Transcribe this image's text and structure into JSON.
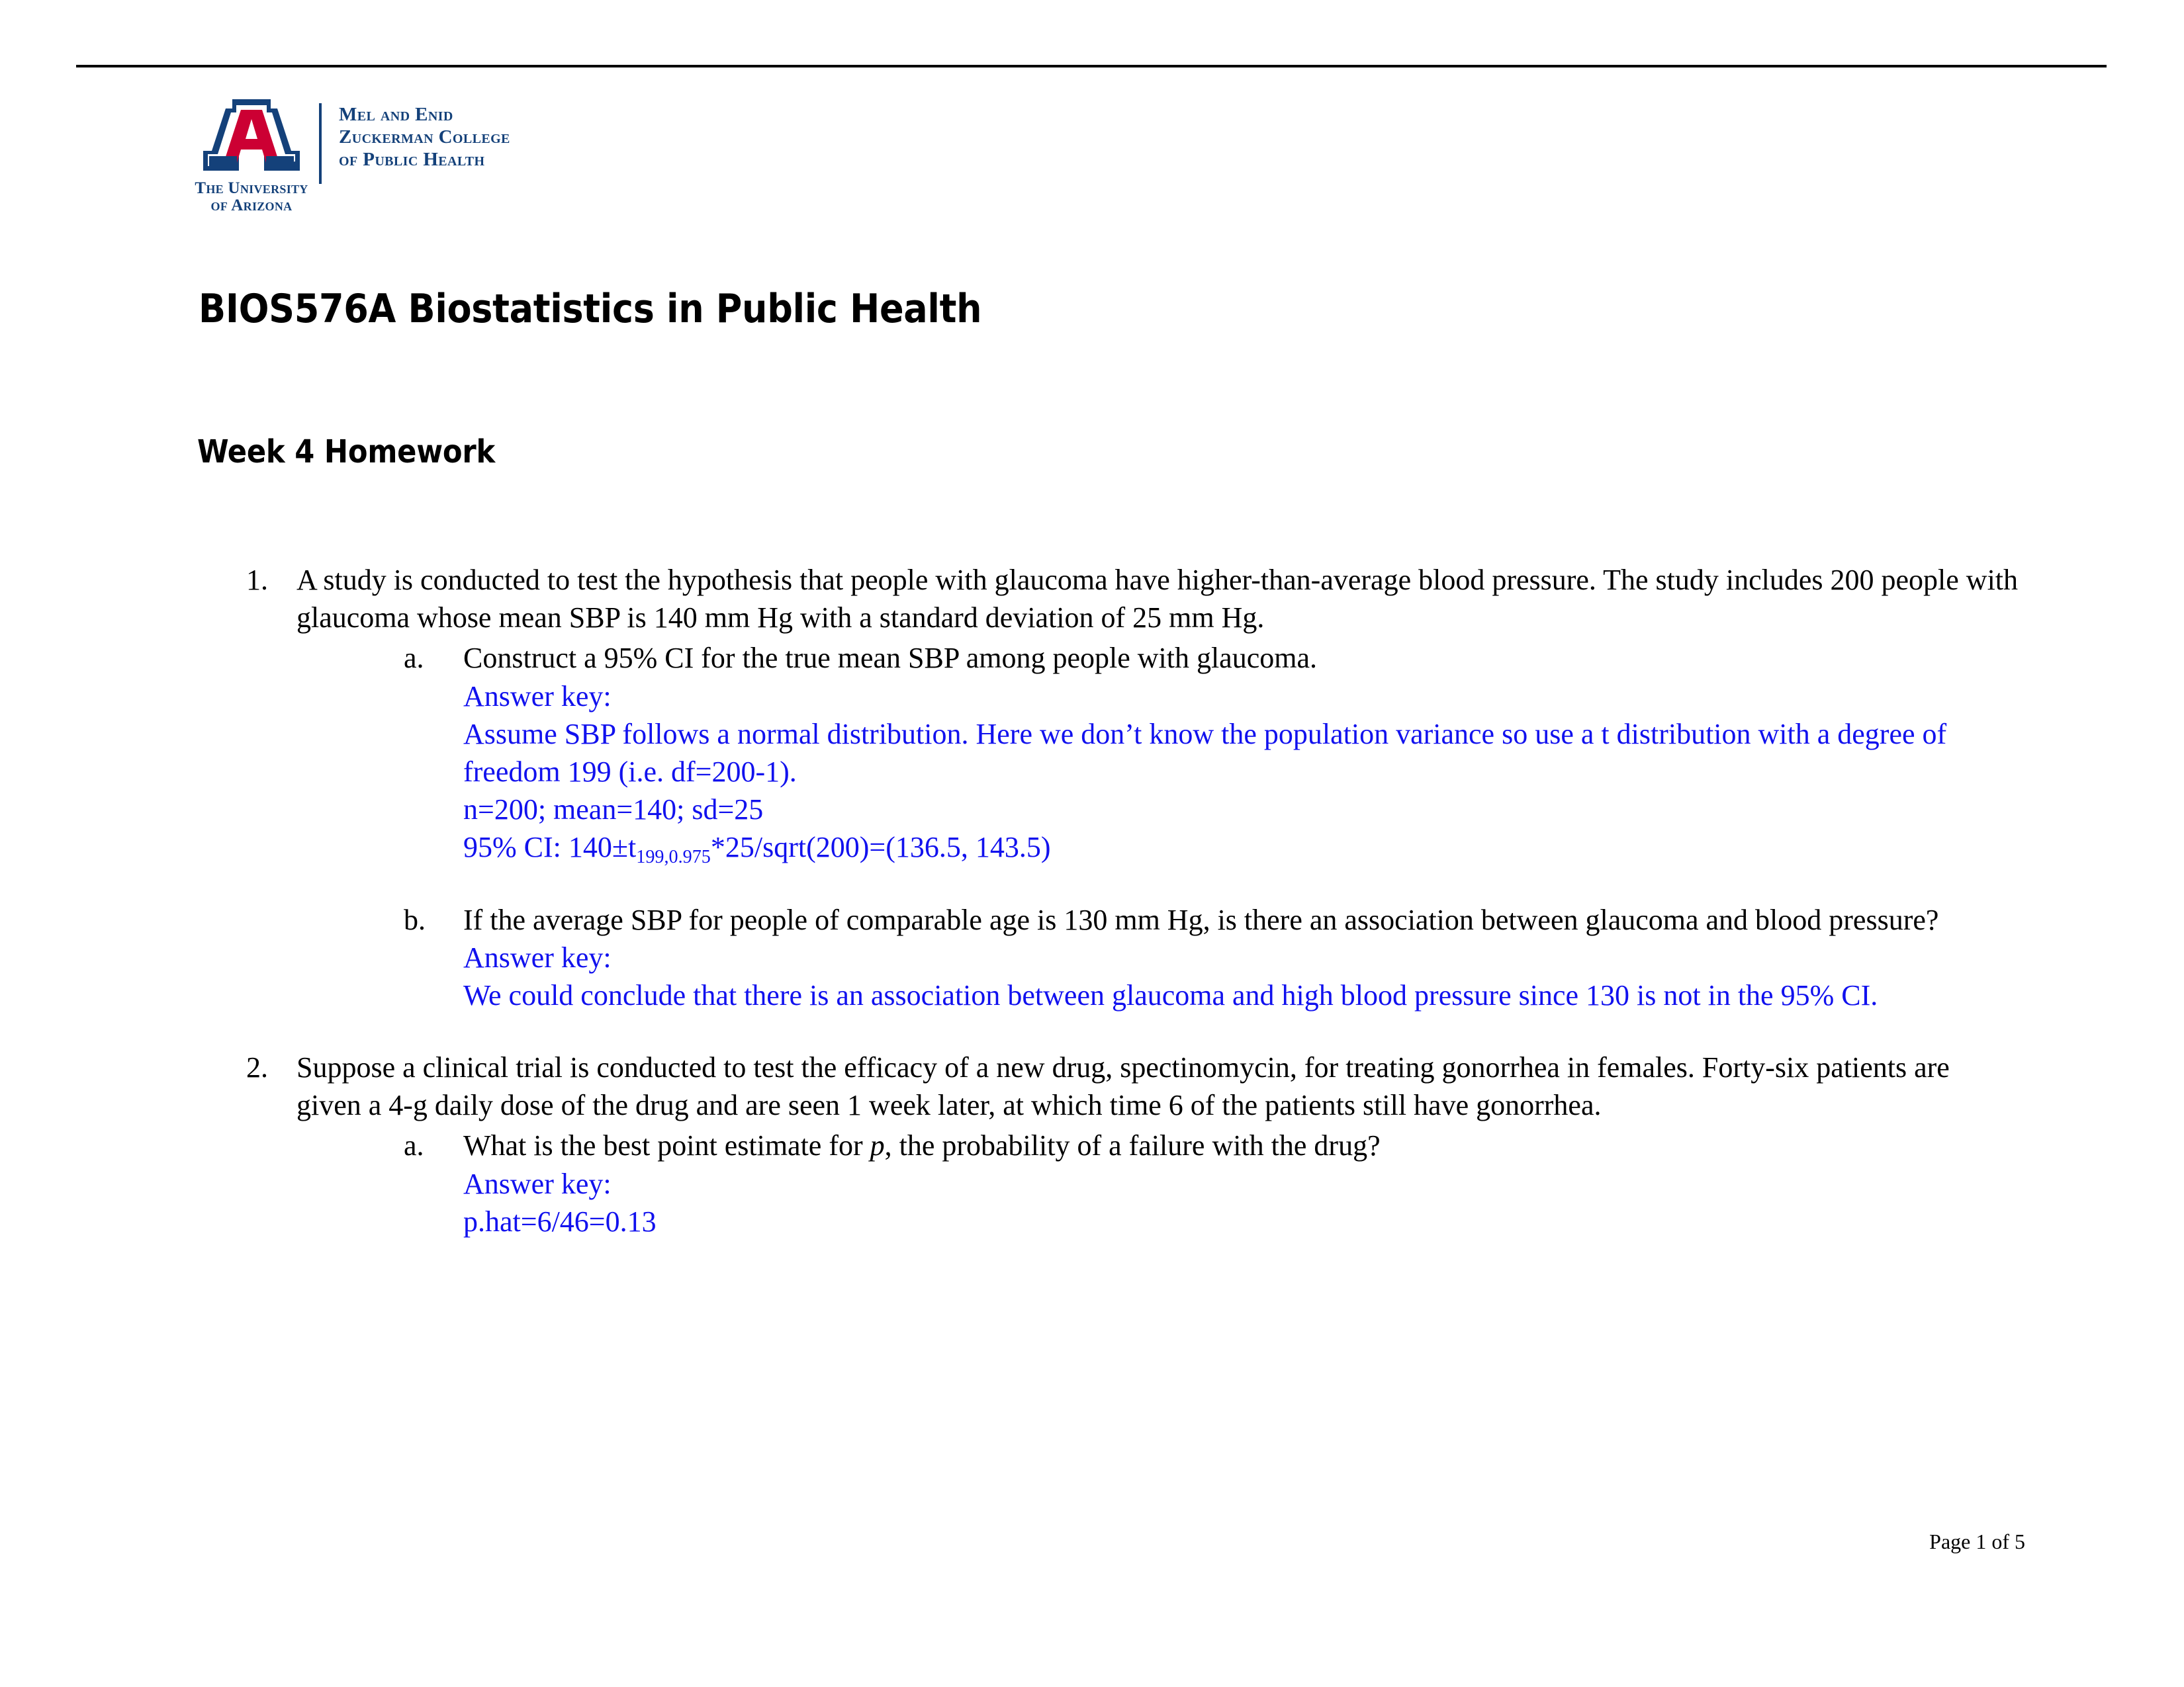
{
  "header": {
    "logo": {
      "mark_alt": "University of Arizona block A",
      "university_line1": "The University",
      "university_line2": "of Arizona",
      "college_line1": "Mel and Enid",
      "college_line2": "Zuckerman College",
      "college_line3": "of Public Health",
      "brand_blue": "#14417a",
      "brand_red": "#cc0033"
    }
  },
  "document": {
    "title": "BIOS576A Biostatistics in Public Health",
    "subtitle": "Week 4 Homework",
    "answer_color": "#1111ee"
  },
  "questions": [
    {
      "number": "1.",
      "text": "A study is conducted to test the hypothesis that people with glaucoma have higher-than-average blood pressure. The study includes 200 people with glaucoma whose mean SBP is 140 mm Hg with a standard deviation of 25 mm Hg.",
      "subparts": [
        {
          "letter": "a.",
          "text": "Construct a 95% CI for the true mean SBP among people with glaucoma.",
          "answer_label": "Answer key:",
          "answer_lines": [
            "Assume SBP follows a normal distribution. Here we don’t know the population variance so use a t distribution with a degree of freedom 199 (i.e. df=200-1).",
            "n=200; mean=140; sd=25"
          ],
          "formula": {
            "prefix": "95% CI: 140±t",
            "subscript": "199,0.975",
            "suffix": "*25/sqrt(200)=(136.5, 143.5)"
          }
        },
        {
          "letter": "b.",
          "text": "If the average SBP for people of comparable age is 130 mm Hg, is there an association between glaucoma and blood pressure?",
          "answer_label": "Answer key:",
          "answer_lines": [
            "We could conclude that there is an association between glaucoma and high blood pressure since 130 is not in the 95% CI."
          ]
        }
      ]
    },
    {
      "number": "2.",
      "text_parts": {
        "before_italic": "Suppose a clinical trial is conducted to test the efficacy of a new drug, spectinomycin, for treating gonorrhea in females. Forty-six patients are given a 4-g daily dose of the drug and are seen 1 week later, at which time 6 of the patients still have gonorrhea."
      },
      "subparts": [
        {
          "letter": "a.",
          "text_before": "What is the best point estimate for ",
          "text_italic": "p",
          "text_after": ", the probability of a failure with the drug?",
          "answer_label": "Answer key:",
          "answer_lines": [
            "p.hat=6/46=0.13"
          ]
        }
      ]
    }
  ],
  "footer": {
    "page_label": "Page 1 of 5"
  }
}
